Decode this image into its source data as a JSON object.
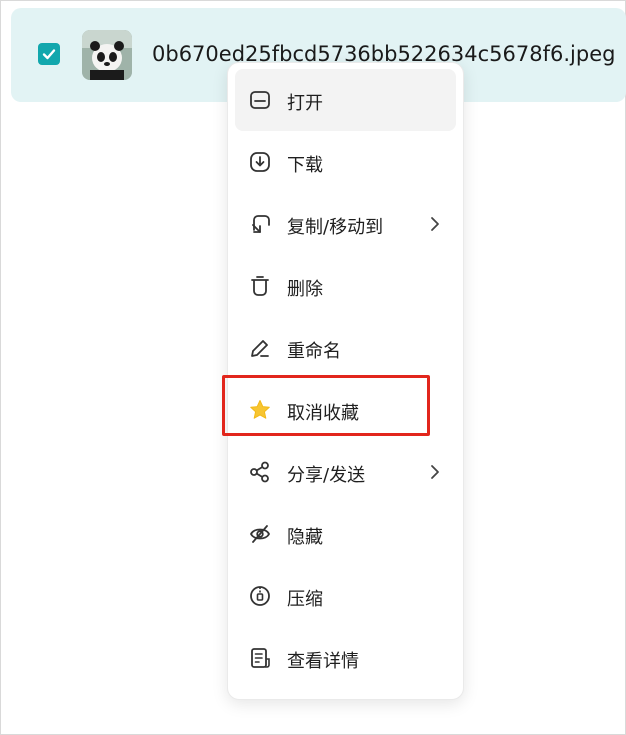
{
  "file": {
    "name": "0b670ed25fbcd5736bb522634c5678f6.jpeg",
    "selected": true,
    "thumbnail_icon": "panda-photo"
  },
  "context_menu": {
    "items": [
      {
        "label": "打开",
        "icon": "open-icon",
        "submenu": false,
        "hovered": true
      },
      {
        "label": "下载",
        "icon": "download-icon",
        "submenu": false
      },
      {
        "label": "复制/移动到",
        "icon": "copy-move-icon",
        "submenu": true
      },
      {
        "label": "删除",
        "icon": "trash-icon",
        "submenu": false
      },
      {
        "label": "重命名",
        "icon": "pencil-icon",
        "submenu": false
      },
      {
        "label": "取消收藏",
        "icon": "star-icon",
        "submenu": false,
        "highlighted": true
      },
      {
        "label": "分享/发送",
        "icon": "share-icon",
        "submenu": true
      },
      {
        "label": "隐藏",
        "icon": "eye-off-icon",
        "submenu": false
      },
      {
        "label": "压缩",
        "icon": "compress-icon",
        "submenu": false
      },
      {
        "label": "查看详情",
        "icon": "details-icon",
        "submenu": false
      }
    ]
  },
  "colors": {
    "accent": "#12a7ad",
    "selected_row_bg": "#e2f3f4",
    "star": "#f7c531",
    "highlight_border": "#e2261c"
  }
}
